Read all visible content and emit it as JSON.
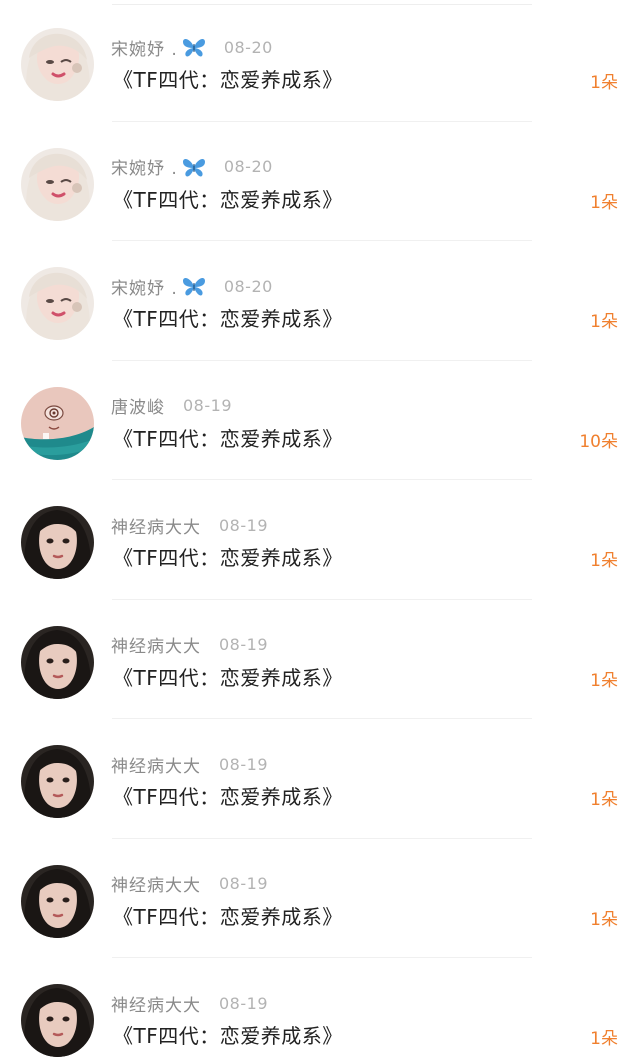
{
  "gifts": [
    {
      "user": "宋婉妤 .",
      "has_butterfly": true,
      "date": "08-20",
      "title": "《TF四代：恋爱养成系》",
      "count": "1朵",
      "avatar": "avatar-blonde"
    },
    {
      "user": "宋婉妤 .",
      "has_butterfly": true,
      "date": "08-20",
      "title": "《TF四代：恋爱养成系》",
      "count": "1朵",
      "avatar": "avatar-blonde"
    },
    {
      "user": "宋婉妤 .",
      "has_butterfly": true,
      "date": "08-20",
      "title": "《TF四代：恋爱养成系》",
      "count": "1朵",
      "avatar": "avatar-blonde"
    },
    {
      "user": "唐波峻",
      "has_butterfly": false,
      "date": "08-19",
      "title": "《TF四代：恋爱养成系》",
      "count": "10朵",
      "avatar": "avatar-face-doodle"
    },
    {
      "user": "神经病大大",
      "has_butterfly": false,
      "date": "08-19",
      "title": "《TF四代：恋爱养成系》",
      "count": "1朵",
      "avatar": "avatar-dark-hair"
    },
    {
      "user": "神经病大大",
      "has_butterfly": false,
      "date": "08-19",
      "title": "《TF四代：恋爱养成系》",
      "count": "1朵",
      "avatar": "avatar-dark-hair"
    },
    {
      "user": "神经病大大",
      "has_butterfly": false,
      "date": "08-19",
      "title": "《TF四代：恋爱养成系》",
      "count": "1朵",
      "avatar": "avatar-dark-hair"
    },
    {
      "user": "神经病大大",
      "has_butterfly": false,
      "date": "08-19",
      "title": "《TF四代：恋爱养成系》",
      "count": "1朵",
      "avatar": "avatar-dark-hair"
    },
    {
      "user": "神经病大大",
      "has_butterfly": false,
      "date": "08-19",
      "title": "《TF四代：恋爱养成系》",
      "count": "1朵",
      "avatar": "avatar-dark-hair"
    }
  ],
  "colors": {
    "count": "#f0802f",
    "username": "#8a8a8a",
    "date": "#b3b3b3",
    "title": "#222222",
    "butterfly": "#4a9be0"
  },
  "icons": {
    "butterfly": "butterfly-icon"
  }
}
